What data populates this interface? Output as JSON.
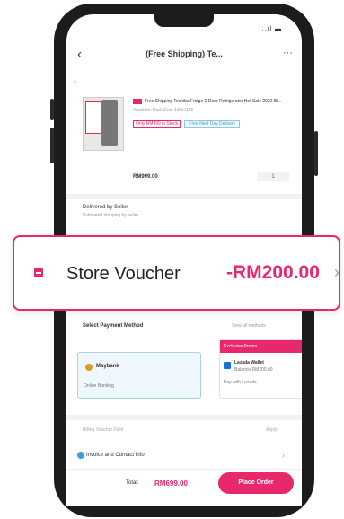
{
  "header": {
    "title": "(Free Shipping) Te...",
    "back_icon": "chevron-left-icon",
    "more_icon": "more-icon"
  },
  "status": {
    "indicators": "..ıl ▬"
  },
  "product": {
    "title": "Free Shipping Toshiba Fridge 2 Door Refrigerator Hot Sale 2022 Bl...",
    "variant": "Variation: Dark Gray 180L/196",
    "tag_1": "Only RM499 in Stock",
    "tag_2": "Free Next Day Delivery",
    "price": "RM999.00",
    "quantity": "1"
  },
  "delivery": {
    "title": "Delivered by Seller",
    "detail": "Estimated shipping by seller"
  },
  "voucher": {
    "label": "Store Voucher",
    "amount": "-RM200.00",
    "accent": "#e8286d"
  },
  "payment": {
    "section_title": "Select Payment Method",
    "view_all": "View all methods",
    "card_title": "Maybank",
    "card_detail": "Online Banking",
    "promo_header": "Exclusive Promo",
    "bank_name": "Lazada Wallet",
    "bank_balance": "Balance RM200.00",
    "bank_note": "Pay with Lazada"
  },
  "billing": {
    "label": "Billing Voucher Field",
    "action": "Apply"
  },
  "invoice": {
    "label": "Invoice and Contact Info"
  },
  "footer": {
    "total_label": "Total:",
    "total_amount": "RM699.00",
    "place_order": "Place Order"
  }
}
